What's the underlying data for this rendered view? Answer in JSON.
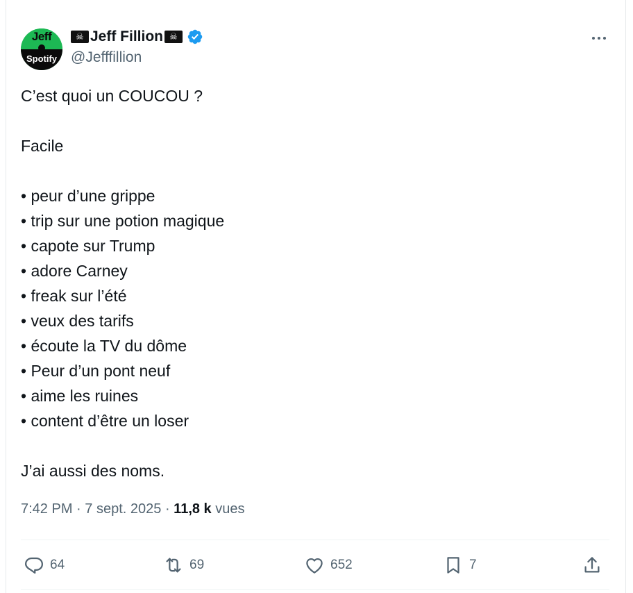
{
  "author": {
    "display_name": "Jeff Fillion",
    "handle": "@Jefffillion",
    "avatar_text_top": "Jeff",
    "avatar_text_bottom": "Spotify",
    "verified": true
  },
  "tweet": {
    "lines": [
      "C’est quoi un COUCOU ?",
      "",
      "Facile",
      "",
      "• peur d’une grippe",
      "• trip sur une potion magique",
      "• capote sur Trump",
      "• adore Carney",
      "• freak sur l’été",
      "• veux des tarifs",
      "• écoute la TV du dôme",
      "• Peur d’un pont neuf",
      "• aime les ruines",
      "• content d’être un loser",
      "",
      "J’ai aussi des noms."
    ]
  },
  "meta": {
    "time": "7:42 PM",
    "date": "7 sept. 2025",
    "views_count": "11,8 k",
    "views_label": "vues",
    "separator": "·"
  },
  "actions": {
    "replies": "64",
    "reposts": "69",
    "likes": "652",
    "bookmarks": "7"
  },
  "colors": {
    "text": "#0f1419",
    "secondary": "#536471",
    "verified": "#1d9bf0",
    "avatar_green": "#1db954"
  },
  "icons": [
    "skull-crossbones-flag-icon",
    "verified-badge-icon",
    "more-icon",
    "reply-icon",
    "repost-icon",
    "like-icon",
    "bookmark-icon",
    "share-icon"
  ]
}
